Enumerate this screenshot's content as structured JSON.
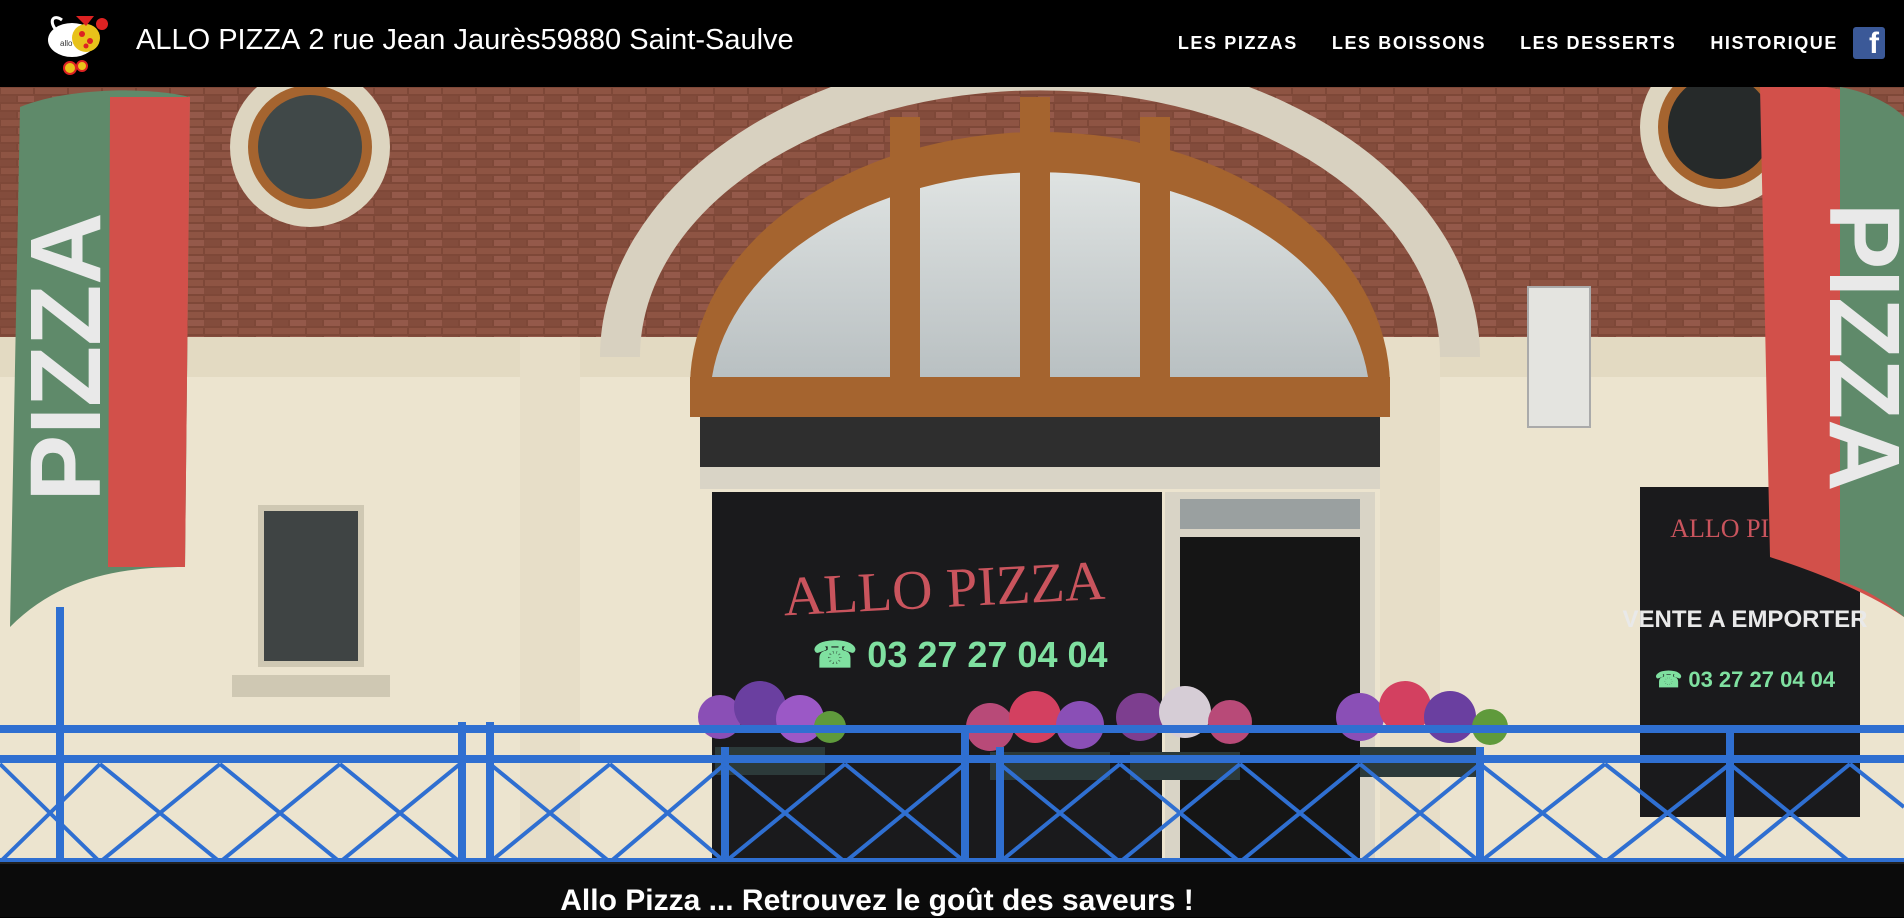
{
  "header": {
    "brand_name": "ALLO PIZZA",
    "address": "2 rue Jean Jaurès59880 Saint-Saulve",
    "logo_icon": "pizza-mascot-logo-icon"
  },
  "nav": {
    "items": [
      {
        "label": "LES PIZZAS"
      },
      {
        "label": "LES BOISSONS"
      },
      {
        "label": "LES DESSERTS"
      },
      {
        "label": "HISTORIQUE"
      }
    ],
    "facebook_icon": "facebook-icon",
    "facebook_glyph": "f"
  },
  "hero": {
    "storefront_sign": "ALLO PIZZA",
    "storefront_phone": "☎ 03 27 27 04 04",
    "banner_text": "PIZZA",
    "side_window_sign_top": "ALLO PIZZA",
    "side_window_sign_mid": "VENTE A EMPORTER",
    "side_window_phone": "☎ 03 27 27 04 04"
  },
  "tagline": "Allo Pizza ... Retrouvez le goût des saveurs !",
  "colors": {
    "nav_bg": "#000000",
    "nav_text": "#ffffff",
    "facebook": "#3b5998",
    "railing": "#2f6fd1",
    "brick": "#8a4a3a",
    "sign_red": "#c9545d",
    "phone_green": "#7fe0a0"
  }
}
